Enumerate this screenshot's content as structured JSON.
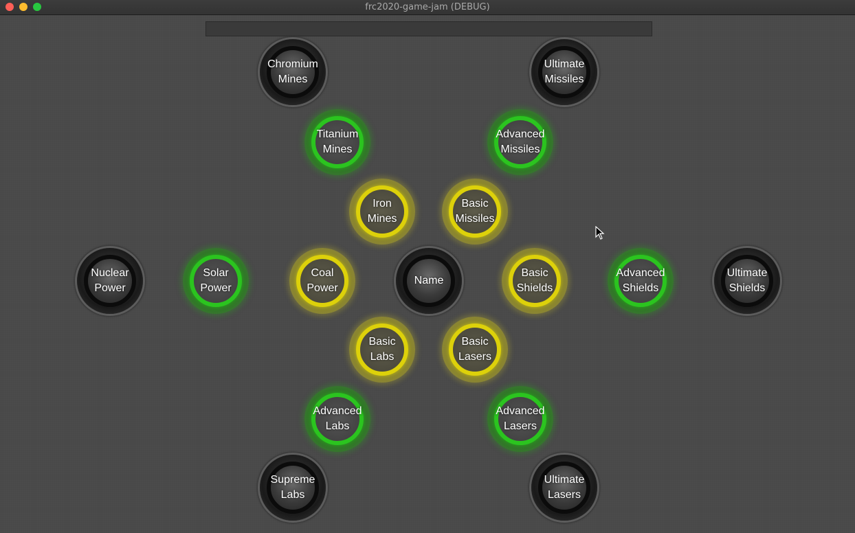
{
  "window": {
    "title": "frc2020-game-jam (DEBUG)",
    "traffic_colors": {
      "close": "#fe5f57",
      "minimize": "#febc2e",
      "maximize": "#28c840"
    }
  },
  "tech_tree": {
    "center": {
      "label": "Name",
      "state": "dark"
    },
    "nodes": [
      {
        "id": "chromium-mines",
        "label": "Chromium\nMines",
        "state": "dark"
      },
      {
        "id": "ultimate-missiles",
        "label": "Ultimate\nMissiles",
        "state": "dark"
      },
      {
        "id": "titanium-mines",
        "label": "Titanium\nMines",
        "state": "green"
      },
      {
        "id": "advanced-missiles",
        "label": "Advanced\nMissiles",
        "state": "green"
      },
      {
        "id": "iron-mines",
        "label": "Iron\nMines",
        "state": "yellow"
      },
      {
        "id": "basic-missiles",
        "label": "Basic\nMissiles",
        "state": "yellow"
      },
      {
        "id": "nuclear-power",
        "label": "Nuclear\nPower",
        "state": "dark"
      },
      {
        "id": "solar-power",
        "label": "Solar\nPower",
        "state": "green"
      },
      {
        "id": "coal-power",
        "label": "Coal\nPower",
        "state": "yellow"
      },
      {
        "id": "basic-shields",
        "label": "Basic\nShields",
        "state": "yellow"
      },
      {
        "id": "advanced-shields",
        "label": "Advanced\nShields",
        "state": "green"
      },
      {
        "id": "ultimate-shields",
        "label": "Ultimate\nShields",
        "state": "dark"
      },
      {
        "id": "basic-labs",
        "label": "Basic\nLabs",
        "state": "yellow"
      },
      {
        "id": "basic-lasers",
        "label": "Basic\nLasers",
        "state": "yellow"
      },
      {
        "id": "advanced-labs",
        "label": "Advanced\nLabs",
        "state": "green"
      },
      {
        "id": "advanced-lasers",
        "label": "Advanced\nLasers",
        "state": "green"
      },
      {
        "id": "supreme-labs",
        "label": "Supreme\nLabs",
        "state": "dark"
      },
      {
        "id": "ultimate-lasers",
        "label": "Ultimate\nLasers",
        "state": "dark"
      }
    ]
  }
}
